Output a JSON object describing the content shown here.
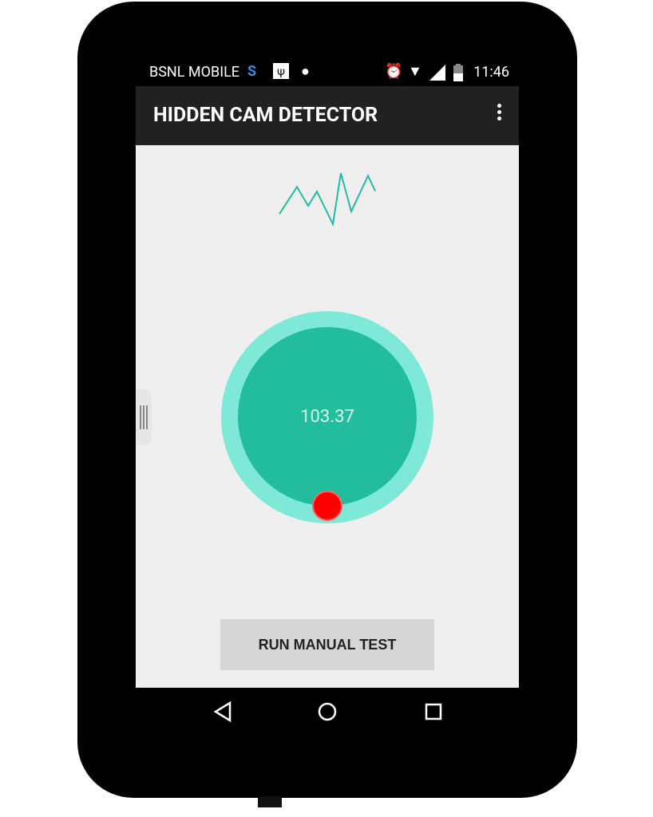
{
  "status_bar": {
    "carrier": "BSNL MOBILE",
    "time": "11:46",
    "icons": [
      "s-app-icon",
      "usb-icon",
      "android-icon",
      "alarm-icon",
      "wifi-icon",
      "signal-icon",
      "battery-charging-icon"
    ]
  },
  "app_bar": {
    "title": "HIDDEN CAM DETECTOR",
    "menu_icon": "more-vert-icon"
  },
  "sparkline": {
    "color": "#22bd9d",
    "values": [
      0.2,
      0.73,
      0.36,
      0.64,
      0.0,
      1.0,
      0.25,
      0.95,
      0.65
    ]
  },
  "meter": {
    "reading": "103.37",
    "outer_color": "#7ee9d6",
    "inner_color": "#22bd9d",
    "indicator_color": "#ff0000"
  },
  "button": {
    "label": "RUN MANUAL TEST"
  },
  "nav_bar": {
    "icons": [
      "back-icon",
      "home-icon",
      "recents-icon"
    ]
  }
}
